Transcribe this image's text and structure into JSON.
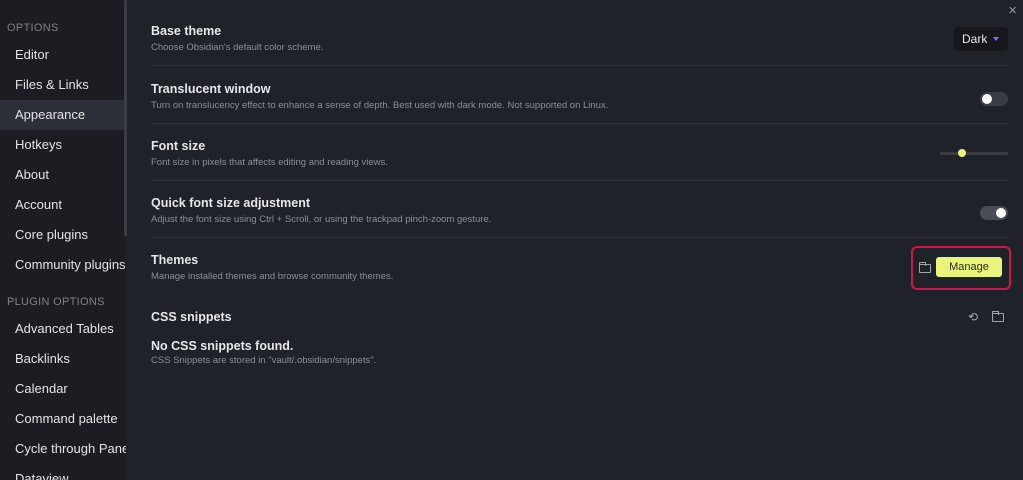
{
  "sidebar": {
    "options_title": "OPTIONS",
    "items": [
      "Editor",
      "Files & Links",
      "Appearance",
      "Hotkeys",
      "About",
      "Account",
      "Core plugins",
      "Community plugins"
    ],
    "active_item": "Appearance",
    "plugin_options_title": "PLUGIN OPTIONS",
    "plugin_items": [
      "Advanced Tables",
      "Backlinks",
      "Calendar",
      "Command palette",
      "Cycle through Panes",
      "Dataview"
    ]
  },
  "header": {
    "close_symbol": "×"
  },
  "settings": {
    "base_theme": {
      "name": "Base theme",
      "desc": "Choose Obsidian's default color scheme.",
      "value": "Dark"
    },
    "translucent": {
      "name": "Translucent window",
      "desc": "Turn on translucency effect to enhance a sense of depth. Best used with dark mode. Not supported on Linux.",
      "enabled": false
    },
    "font_size": {
      "name": "Font size",
      "desc": "Font size in pixels that affects editing and reading views.",
      "level": 0.32
    },
    "quick_font": {
      "name": "Quick font size adjustment",
      "desc": "Adjust the font size using Ctrl + Scroll, or using the trackpad pinch-zoom gesture.",
      "enabled": true
    },
    "themes": {
      "name": "Themes",
      "desc": "Manage installed themes and browse community themes.",
      "button": "Manage"
    },
    "css_snippets": {
      "name": "CSS snippets"
    },
    "no_snippets": {
      "name": "No CSS snippets found.",
      "desc": "CSS Snippets are stored in \"vault/.obsidian/snippets\"."
    }
  },
  "icons": {
    "close": "close-icon",
    "dropdown": "chevron-down-icon",
    "folder": "folder-icon",
    "reload": "reload-icon"
  },
  "colors": {
    "accent": "#e8f47a",
    "highlight_border": "#d1154a",
    "dropdown_chevron": "#8c6df2",
    "toggle_on": "#4a4d55",
    "toggle_off": "#3a3d45"
  }
}
